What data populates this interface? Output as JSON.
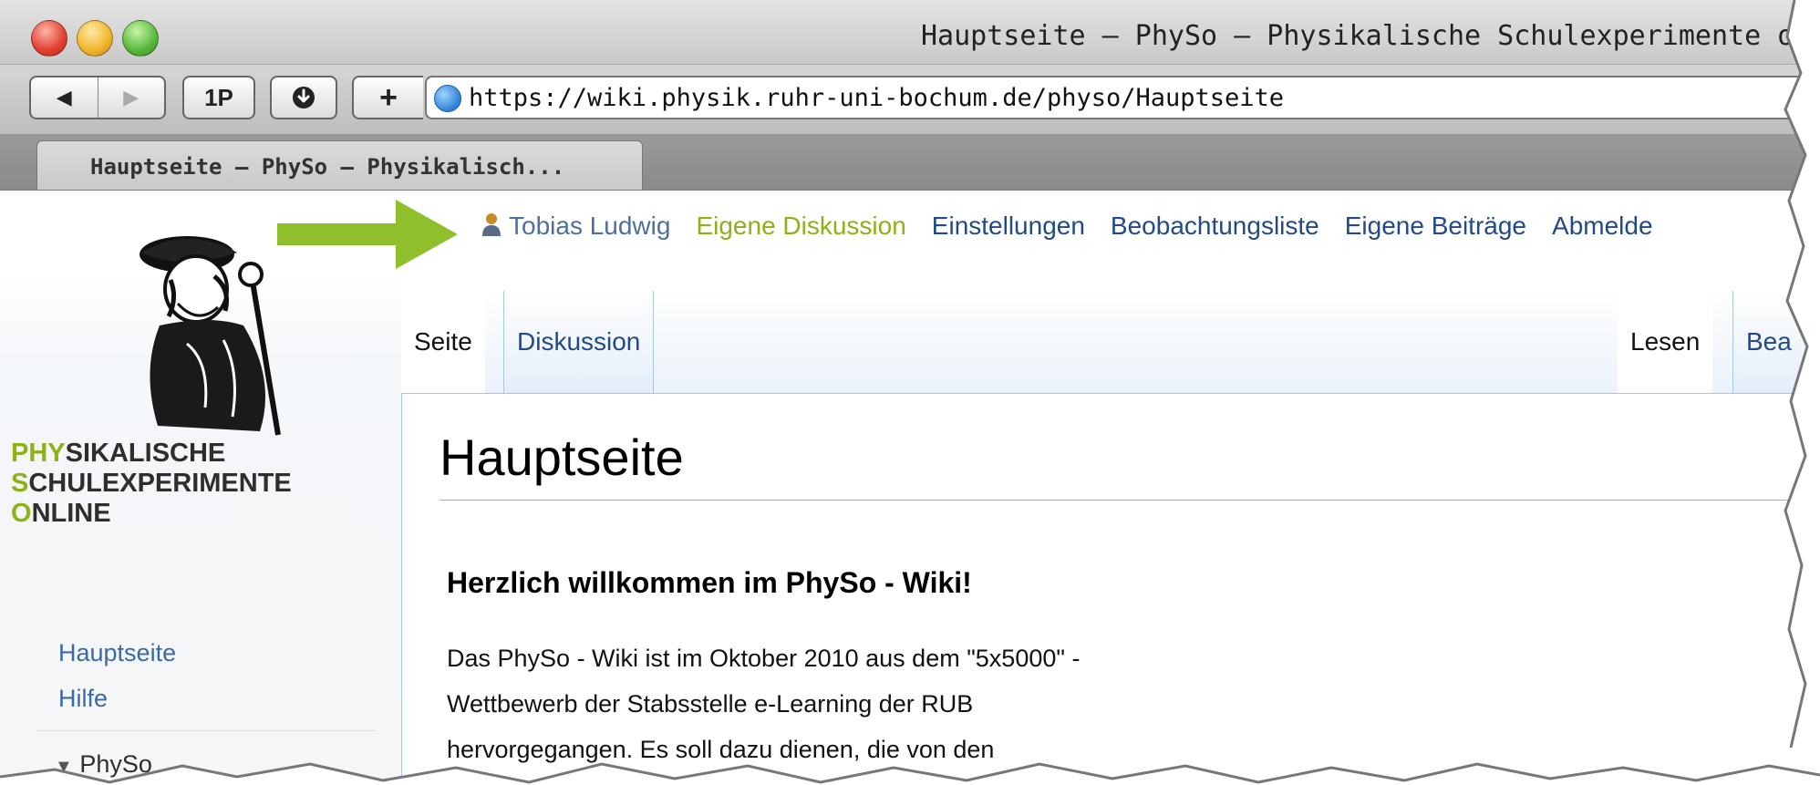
{
  "window": {
    "title": "Hauptseite – PhySo – Physikalische Schulexperimente onli"
  },
  "toolbar": {
    "back_label": "◀",
    "forward_label": "▶",
    "onepassword_label": "1P",
    "download_label": "⬇",
    "new_tab_label": "+",
    "url": "https://wiki.physik.ruhr-uni-bochum.de/physo/Hauptseite"
  },
  "tabbar": {
    "active_tab": "Hauptseite – PhySo – Physikalisch..."
  },
  "personal": {
    "user": "Tobias Ludwig",
    "links": [
      "Eigene Diskussion",
      "Einstellungen",
      "Beobachtungsliste",
      "Eigene Beiträge",
      "Abmelde"
    ]
  },
  "sidebar": {
    "brand": {
      "line1_accent": "PHY",
      "line1_rest": "SIKALISCHE",
      "line2_accent": "S",
      "line2_rest": "CHULEXPERIMENTE",
      "line3_accent": "O",
      "line3_rest": "NLINE"
    },
    "nav": [
      "Hauptseite",
      "Hilfe"
    ],
    "portlet": "PhySo"
  },
  "tabs": {
    "page": "Seite",
    "discussion": "Diskussion",
    "read": "Lesen",
    "edit": "Bea"
  },
  "content": {
    "heading": "Hauptseite",
    "welcome": "Herzlich willkommen im PhySo - Wiki!",
    "paragraph_lines": [
      "Das PhySo - Wiki ist im Oktober 2010 aus dem \"5x5000\" -",
      "Wettbewerb der Stabsstelle e-Learning der RUB",
      "hervorgegangen. Es soll dazu dienen, die von den"
    ]
  },
  "colors": {
    "accent_green": "#8cb218",
    "link_blue": "#224a86",
    "user_blue": "#4d6f9b"
  }
}
